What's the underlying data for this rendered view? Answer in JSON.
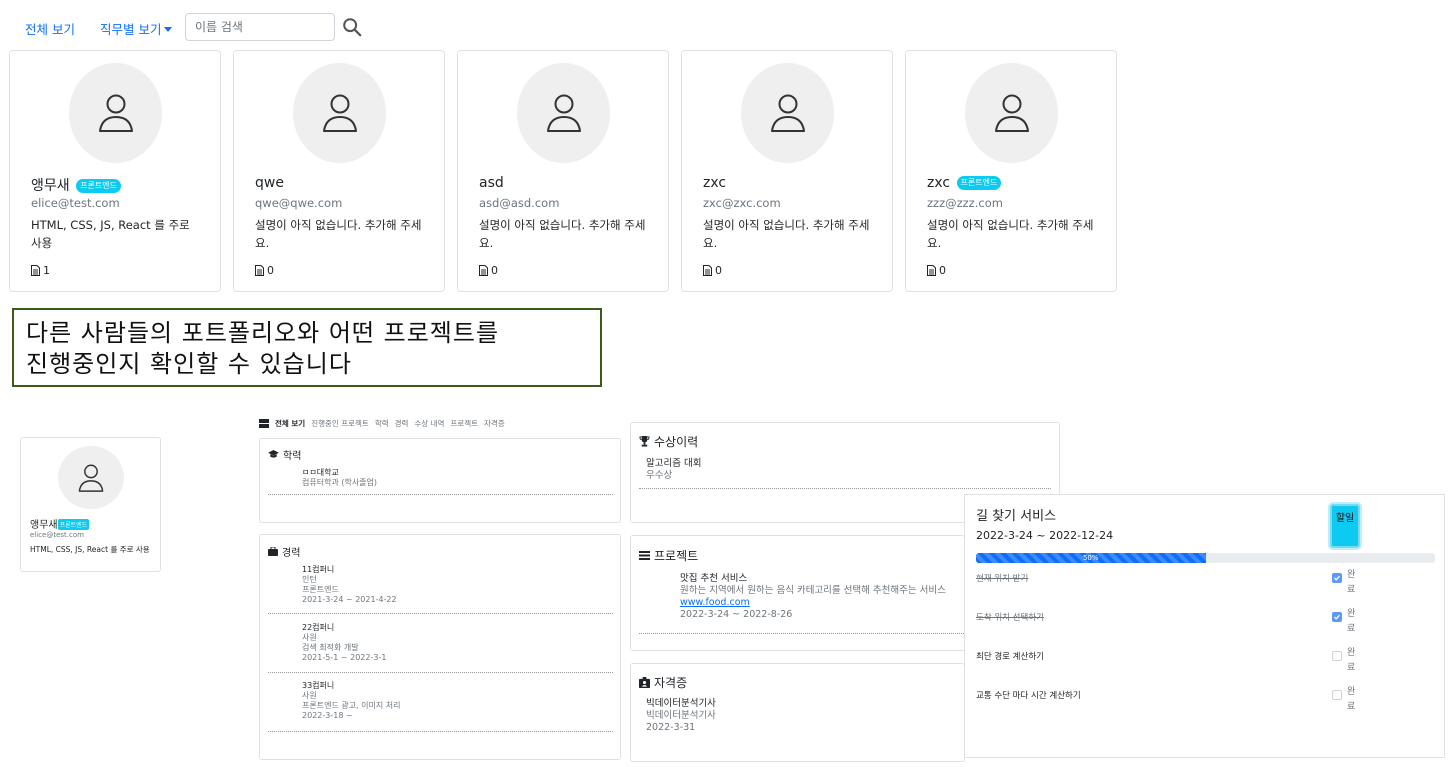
{
  "nav": {
    "all_label": "전체 보기",
    "by_job_label": "직무별 보기",
    "search_placeholder": "이름 검색"
  },
  "users": [
    {
      "name": "앵무새",
      "badge": "프론트엔드",
      "email": "elice@test.com",
      "desc": "HTML, CSS, JS, React 를 주로 사용",
      "count": "1"
    },
    {
      "name": "qwe",
      "badge": "",
      "email": "qwe@qwe.com",
      "desc": "설명이 아직 없습니다. 추가해 주세요.",
      "count": "0"
    },
    {
      "name": "asd",
      "badge": "",
      "email": "asd@asd.com",
      "desc": "설명이 아직 없습니다. 추가해 주세요.",
      "count": "0"
    },
    {
      "name": "zxc",
      "badge": "",
      "email": "zxc@zxc.com",
      "desc": "설명이 아직 없습니다. 추가해 주세요.",
      "count": "0"
    },
    {
      "name": "zxc",
      "badge": "프론트엔드",
      "email": "zzz@zzz.com",
      "desc": "설명이 아직 없습니다. 추가해 주세요.",
      "count": "0"
    }
  ],
  "caption": {
    "line1": "다른 사람들의 포트폴리오와 어떤 프로젝트를",
    "line2": "진행중인지 확인할 수 있습니다"
  },
  "detail": {
    "profile": {
      "name": "앵무새",
      "badge": "프론트엔드",
      "email": "elice@test.com",
      "desc": "HTML, CSS, JS, React 를 주로 사용"
    },
    "tabs": [
      "전체 보기",
      "진행중인 프로젝트",
      "학력",
      "경력",
      "수상 내역",
      "프로젝트",
      "자격증"
    ],
    "education": {
      "title": "학력",
      "school": "ㅁㅁ대학교",
      "major": "컴퓨터학과 (학사졸업)"
    },
    "career": {
      "title": "경력",
      "items": [
        {
          "company": "11컴퍼니",
          "position": "인턴",
          "role": "프론트엔드",
          "period": "2021-3-24 ~ 2021-4-22"
        },
        {
          "company": "22컴퍼니",
          "position": "사원",
          "role": "검색 최적화 개발",
          "period": "2021-5-1 ~ 2022-3-1"
        },
        {
          "company": "33컴퍼니",
          "position": "사원",
          "role": "프론트엔드 광고, 이미지 처리",
          "period": "2022-3-18 ~"
        }
      ]
    },
    "awards": {
      "title": "수상이력",
      "name": "알고리즘 대회",
      "grade": "우수상"
    },
    "projects": {
      "title": "프로젝트",
      "name": "맛집 추천 서비스",
      "desc": "원하는 지역에서 원하는 음식 카테고리를 선택해 추천해주는 서비스",
      "link": "www.food.com",
      "period": "2022-3-24 ~ 2022-8-26"
    },
    "certs": {
      "title": "자격증",
      "name": "빅데이터분석기사",
      "issuer": "빅데이터분석기사",
      "date": "2022-3-31"
    },
    "todo": {
      "title": "길 찾기 서비스",
      "period": "2022-3-24 ~ 2022-12-24",
      "button_label": "할일",
      "progress": 50,
      "progress_label": "50%",
      "tasks": [
        {
          "text": "현재 위치 받기",
          "done": true,
          "label": "완료"
        },
        {
          "text": "도착 위치 선택하기",
          "done": true,
          "label": "완료"
        },
        {
          "text": "최단 경로 계산하기",
          "done": false,
          "label": "완료"
        },
        {
          "text": "교통 수단 마다 시간 계산하기",
          "done": false,
          "label": "완료"
        }
      ]
    }
  }
}
